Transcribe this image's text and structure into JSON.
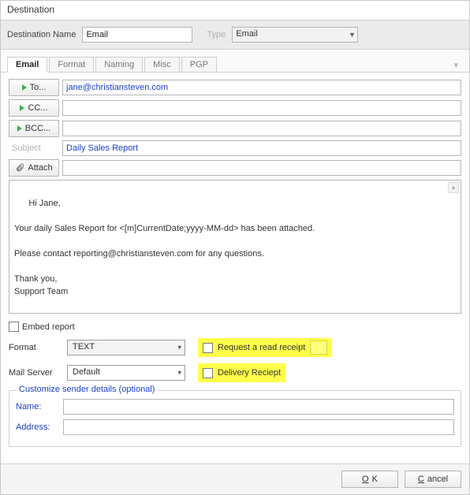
{
  "window": {
    "title": "Destination"
  },
  "header": {
    "dest_name_label": "Destination Name",
    "dest_name_value": "Email",
    "type_label": "Type",
    "type_value": "Email"
  },
  "tabs": {
    "email": "Email",
    "format": "Format",
    "naming": "Naming",
    "misc": "Misc",
    "pgp": "PGP"
  },
  "email": {
    "to_label": "To...",
    "to_value": "jane@christiansteven.com",
    "cc_label": "CC...",
    "cc_value": "",
    "bcc_label": "BCC...",
    "bcc_value": "",
    "subject_label": "Subject",
    "subject_value": "Daily Sales Report",
    "attach_label": "Attach",
    "attach_value": "",
    "body": "Hi Jane,\n\nYour daily Sales Report for <[m]CurrentDate;yyyy-MM-dd> has been attached.\n\nPlease contact reporting@christiansteven.com for any questions.\n\nThank you,\nSupport Team"
  },
  "options": {
    "embed_report_label": "Embed report",
    "format_label": "Format",
    "format_value": "TEXT",
    "mail_server_label": "Mail Server",
    "mail_server_value": "Default",
    "read_receipt_label": "Request a read receipt",
    "delivery_receipt_label": "Delivery Reciept"
  },
  "sender_group": {
    "title": "Customize sender details (optional)",
    "name_label": "Name:",
    "name_value": "",
    "address_label": "Address:",
    "address_value": ""
  },
  "footer": {
    "ok": "OK",
    "cancel": "Cancel"
  }
}
